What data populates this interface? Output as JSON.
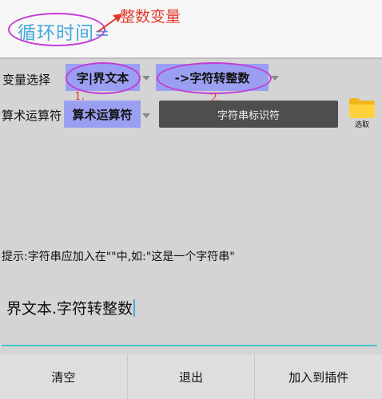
{
  "variable_field": {
    "value": "循环时间="
  },
  "annotations": {
    "integer_variable_note": "整数变量",
    "marker_1": "1.",
    "marker_2": "2."
  },
  "variable_row": {
    "label": "变量选择",
    "variable_dropdown": "字|界文本",
    "conversion_dropdown": "->字符转整数"
  },
  "operator_row": {
    "label": "算术运算符",
    "operator_dropdown": "算术运算符",
    "operator_button": "字符串标识符",
    "pick_label": "选取"
  },
  "hint": "提示:字符串应加入在\"\"中,如:\"这是一个字符串\"",
  "expression": "界文本.字符转整数",
  "footer": {
    "clear": "清空",
    "exit": "退出",
    "add_to_plugin": "加入到插件"
  },
  "colors": {
    "accent": "#45a9d8",
    "spinner_bg": "#9b9ff2",
    "highlight_ellipse": "#c43bd7",
    "annotation_red": "#e23b2d",
    "button_dark": "#4e4e4e"
  }
}
